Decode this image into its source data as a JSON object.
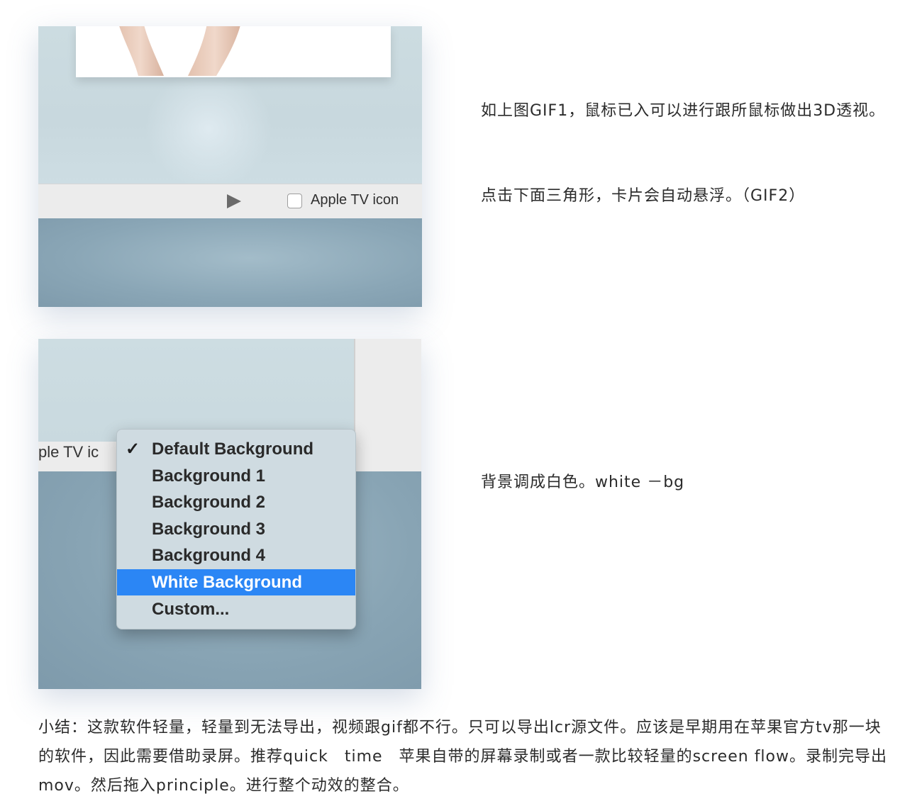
{
  "screenshot1": {
    "checkbox_label": "Apple TV icon"
  },
  "screenshot2": {
    "toolbar_partial_label": "ple TV ic",
    "menu": {
      "checkmark": "✓",
      "items": [
        {
          "label": "Default Background",
          "checked": true,
          "selected": false
        },
        {
          "label": "Background 1",
          "checked": false,
          "selected": false
        },
        {
          "label": "Background 2",
          "checked": false,
          "selected": false
        },
        {
          "label": "Background 3",
          "checked": false,
          "selected": false
        },
        {
          "label": "Background 4",
          "checked": false,
          "selected": false
        },
        {
          "label": "White Background",
          "checked": false,
          "selected": true
        },
        {
          "label": "Custom...",
          "checked": false,
          "selected": false
        }
      ],
      "highlight_color": "#2b86f5"
    }
  },
  "text": {
    "para1": "如上图GIF1，鼠标已入可以进行跟所鼠标做出3D透视。",
    "para2": "点击下面三角形，卡片会自动悬浮。（GIF2）",
    "para3": "背景调成白色。white －bg",
    "summary": "小结：这款软件轻量，轻量到无法导出，视频跟gif都不行。只可以导出lcr源文件。应该是早期用在苹果官方tv那一块的软件，因此需要借助录屏。推荐quick　time　苹果自带的屏幕录制或者一款比较轻量的screen flow。录制完导出mov。然后拖入principle。进行整个动效的整合。"
  }
}
